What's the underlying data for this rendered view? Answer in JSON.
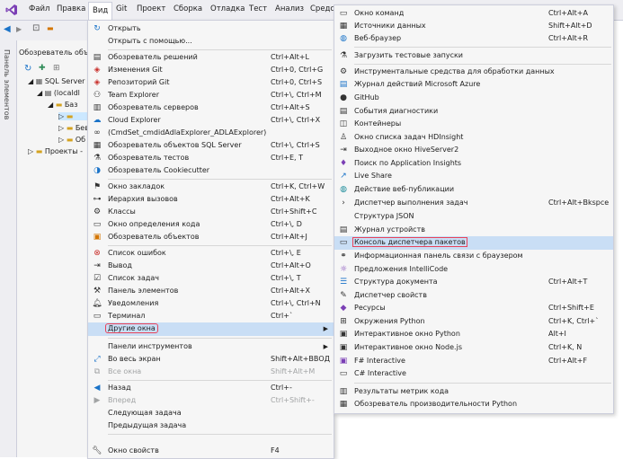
{
  "menubar": {
    "items": [
      "Файл",
      "Правка",
      "Вид",
      "Git",
      "Проект",
      "Сборка",
      "Отладка",
      "Тест",
      "Анализ",
      "Средст"
    ]
  },
  "left_panel": {
    "vertical_label": "Панель элементов",
    "explorer_title": "Обозреватель объе",
    "tree": [
      "SQL Server",
      "(localdl",
      "Баз",
      "",
      "Бев",
      "Об",
      "Проекты -"
    ]
  },
  "view_menu": {
    "items": [
      {
        "icon": "open-icon",
        "label": "Открыть",
        "shortcut": ""
      },
      {
        "icon": "",
        "label": "Открыть с помощью...",
        "shortcut": ""
      },
      {
        "icon": "solution-explorer-icon",
        "label": "Обозреватель решений",
        "shortcut": "Ctrl+Alt+L"
      },
      {
        "icon": "git-changes-icon",
        "label": "Изменения Git",
        "shortcut": "Ctrl+0, Ctrl+G"
      },
      {
        "icon": "git-repository-icon",
        "label": "Репозиторий Git",
        "shortcut": "Ctrl+0, Ctrl+S"
      },
      {
        "icon": "team-explorer-icon",
        "label": "Team Explorer",
        "shortcut": "Ctrl+\\, Ctrl+M"
      },
      {
        "icon": "server-explorer-icon",
        "label": "Обозреватель серверов",
        "shortcut": "Ctrl+Alt+S"
      },
      {
        "icon": "cloud-explorer-icon",
        "label": "Cloud Explorer",
        "shortcut": "Ctrl+\\, Ctrl+X"
      },
      {
        "icon": "adla-icon",
        "label": "(CmdSet_cmdidAdlaExplorer_ADLAExplorer)",
        "shortcut": ""
      },
      {
        "icon": "sql-server-icon",
        "label": "Обозреватель объектов SQL Server",
        "shortcut": "Ctrl+\\, Ctrl+S"
      },
      {
        "icon": "test-explorer-icon",
        "label": "Обозреватель тестов",
        "shortcut": "Ctrl+E, T"
      },
      {
        "icon": "cookiecutter-icon",
        "label": "Обозреватель Cookiecutter",
        "shortcut": ""
      },
      {
        "icon": "bookmark-icon",
        "label": "Окно закладок",
        "shortcut": "Ctrl+K, Ctrl+W"
      },
      {
        "icon": "call-hierarchy-icon",
        "label": "Иерархия вызовов",
        "shortcut": "Ctrl+Alt+K"
      },
      {
        "icon": "classes-icon",
        "label": "Классы",
        "shortcut": "Ctrl+Shift+C"
      },
      {
        "icon": "code-definition-icon",
        "label": "Окно определения кода",
        "shortcut": "Ctrl+\\, D"
      },
      {
        "icon": "object-browser-icon",
        "label": "Обозреватель объектов",
        "shortcut": "Ctrl+Alt+J"
      },
      {
        "icon": "error-list-icon",
        "label": "Список ошибок",
        "shortcut": "Ctrl+\\, E"
      },
      {
        "icon": "output-icon",
        "label": "Вывод",
        "shortcut": "Ctrl+Alt+O"
      },
      {
        "icon": "task-list-icon",
        "label": "Список задач",
        "shortcut": "Ctrl+\\, T"
      },
      {
        "icon": "toolbox-icon",
        "label": "Панель элементов",
        "shortcut": "Ctrl+Alt+X"
      },
      {
        "icon": "notifications-icon",
        "label": "Уведомления",
        "shortcut": "Ctrl+\\, Ctrl+N"
      },
      {
        "icon": "terminal-icon",
        "label": "Терминал",
        "shortcut": "Ctrl+`"
      },
      {
        "icon": "",
        "label": "Другие окна",
        "shortcut": ""
      },
      {
        "icon": "",
        "label": "Панели инструментов",
        "shortcut": ""
      },
      {
        "icon": "full-screen-icon",
        "label": "Во весь экран",
        "shortcut": "Shift+Alt+ВВОД"
      },
      {
        "icon": "all-windows-icon",
        "label": "Все окна",
        "shortcut": "Shift+Alt+M"
      },
      {
        "icon": "back-icon",
        "label": "Назад",
        "shortcut": "Ctrl+-"
      },
      {
        "icon": "forward-icon",
        "label": "Вперед",
        "shortcut": "Ctrl+Shift+-"
      },
      {
        "icon": "",
        "label": "Следующая задача",
        "shortcut": ""
      },
      {
        "icon": "",
        "label": "Предыдущая задача",
        "shortcut": ""
      },
      {
        "icon": "properties-icon",
        "label": "Окно свойств",
        "shortcut": "F4"
      }
    ]
  },
  "other_windows_menu": {
    "items": [
      {
        "icon": "command-window-icon",
        "label": "Окно команд",
        "shortcut": "Ctrl+Alt+A"
      },
      {
        "icon": "data-sources-icon",
        "label": "Источники данных",
        "shortcut": "Shift+Alt+D"
      },
      {
        "icon": "web-browser-icon",
        "label": "Веб-браузер",
        "shortcut": "Ctrl+Alt+R"
      },
      {
        "icon": "test-runs-icon",
        "label": "Загрузить тестовые запуски",
        "shortcut": ""
      },
      {
        "icon": "data-tools-icon",
        "label": "Инструментальные средства для обработки данных",
        "shortcut": ""
      },
      {
        "icon": "azure-log-icon",
        "label": "Журнал действий Microsoft Azure",
        "shortcut": ""
      },
      {
        "icon": "github-icon",
        "label": "GitHub",
        "shortcut": ""
      },
      {
        "icon": "diagnostics-icon",
        "label": "События диагностики",
        "shortcut": ""
      },
      {
        "icon": "containers-icon",
        "label": "Контейнеры",
        "shortcut": ""
      },
      {
        "icon": "hdinsight-icon",
        "label": "Окно списка задач HDInsight",
        "shortcut": ""
      },
      {
        "icon": "hiveserver-icon",
        "label": "Выходное окно HiveServer2",
        "shortcut": ""
      },
      {
        "icon": "app-insights-icon",
        "label": "Поиск по Application Insights",
        "shortcut": ""
      },
      {
        "icon": "live-share-icon",
        "label": "Live Share",
        "shortcut": ""
      },
      {
        "icon": "web-publish-icon",
        "label": "Действие веб-публикации",
        "shortcut": ""
      },
      {
        "icon": "task-runner-icon",
        "label": "Диспетчер выполнения задач",
        "shortcut": "Ctrl+Alt+Bkspce"
      },
      {
        "icon": "",
        "label": "Структура JSON",
        "shortcut": ""
      },
      {
        "icon": "device-log-icon",
        "label": "Журнал устройств",
        "shortcut": ""
      },
      {
        "icon": "package-console-icon",
        "label": "Консоль диспетчера пакетов",
        "shortcut": ""
      },
      {
        "icon": "browser-link-icon",
        "label": "Информационная панель связи с браузером",
        "shortcut": ""
      },
      {
        "icon": "intellicode-icon",
        "label": "Предложения IntelliCode",
        "shortcut": ""
      },
      {
        "icon": "document-outline-icon",
        "label": "Структура документа",
        "shortcut": "Ctrl+Alt+T"
      },
      {
        "icon": "property-manager-icon",
        "label": "Диспетчер свойств",
        "shortcut": ""
      },
      {
        "icon": "resources-icon",
        "label": "Ресурсы",
        "shortcut": "Ctrl+Shift+E"
      },
      {
        "icon": "python-env-icon",
        "label": "Окружения Python",
        "shortcut": "Ctrl+K, Ctrl+`"
      },
      {
        "icon": "python-interactive-icon",
        "label": "Интерактивное окно Python",
        "shortcut": "Alt+I"
      },
      {
        "icon": "node-interactive-icon",
        "label": "Интерактивное окно Node.js",
        "shortcut": "Ctrl+K, N"
      },
      {
        "icon": "fsharp-icon",
        "label": "F# Interactive",
        "shortcut": "Ctrl+Alt+F"
      },
      {
        "icon": "csharp-icon",
        "label": "C# Interactive",
        "shortcut": ""
      },
      {
        "icon": "code-metrics-icon",
        "label": "Результаты метрик кода",
        "shortcut": ""
      },
      {
        "icon": "python-profiler-icon",
        "label": "Обозреватель производительности Python",
        "shortcut": ""
      }
    ]
  },
  "colors": {
    "highlight": "#c9def5",
    "annotation": "#e8435a",
    "menu_bg": "#f6f6f6",
    "vs_purple": "#7b3fb5"
  }
}
